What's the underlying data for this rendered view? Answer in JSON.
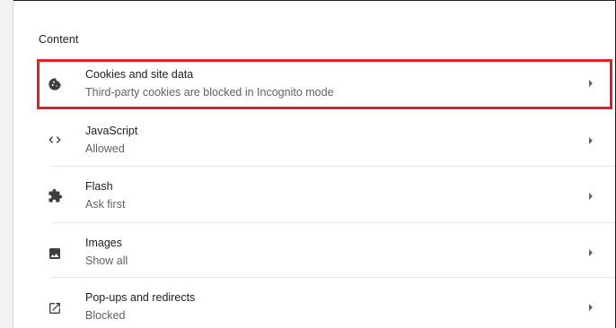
{
  "section": {
    "title": "Content"
  },
  "rows": [
    {
      "id": "cookies",
      "label": "Cookies and site data",
      "sublabel": "Third-party cookies are blocked in Incognito mode",
      "icon": "cookie-icon"
    },
    {
      "id": "javascript",
      "label": "JavaScript",
      "sublabel": "Allowed",
      "icon": "code-icon"
    },
    {
      "id": "flash",
      "label": "Flash",
      "sublabel": "Ask first",
      "icon": "puzzle-piece-icon"
    },
    {
      "id": "images",
      "label": "Images",
      "sublabel": "Show all",
      "icon": "image-icon"
    },
    {
      "id": "popups",
      "label": "Pop-ups and redirects",
      "sublabel": "Blocked",
      "icon": "open-in-new-icon"
    }
  ],
  "colors": {
    "highlight_border": "#e0202e",
    "text_primary": "#202124",
    "text_secondary": "#5f6368"
  }
}
